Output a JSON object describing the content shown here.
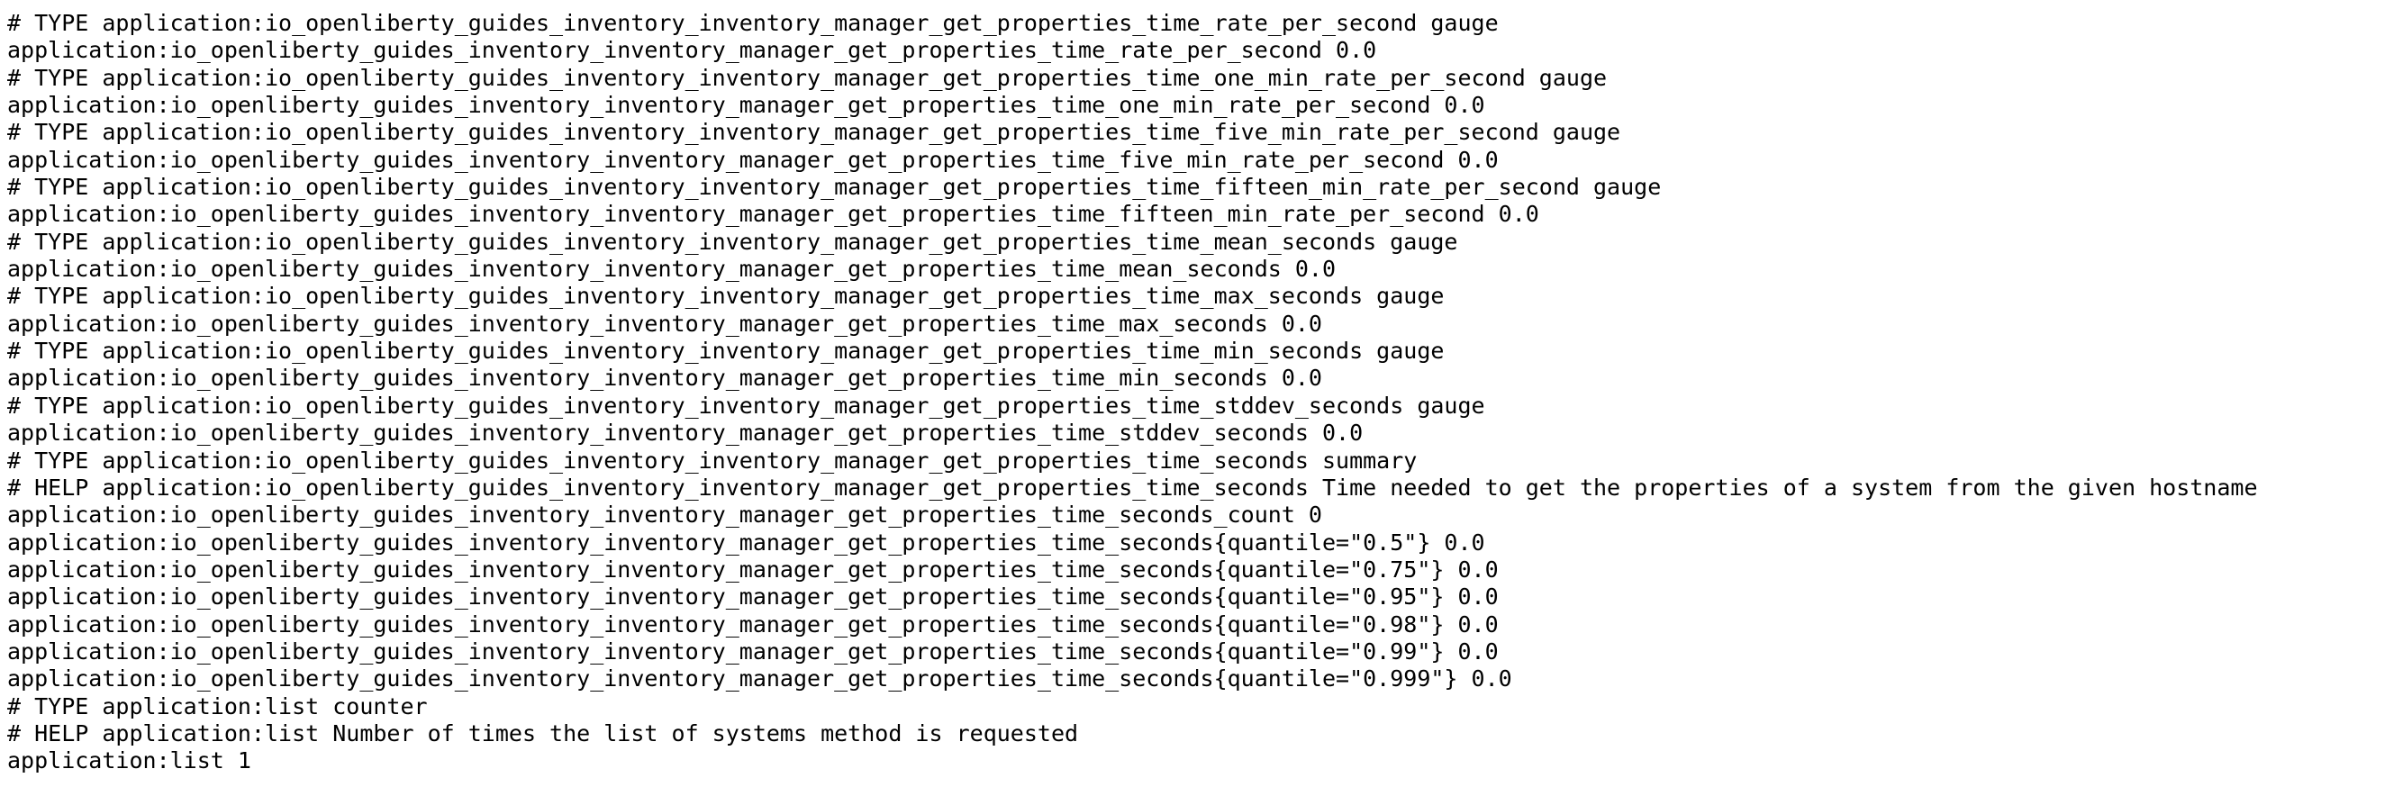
{
  "metrics": {
    "lines": [
      "# TYPE application:io_openliberty_guides_inventory_inventory_manager_get_properties_time_rate_per_second gauge",
      "application:io_openliberty_guides_inventory_inventory_manager_get_properties_time_rate_per_second 0.0",
      "# TYPE application:io_openliberty_guides_inventory_inventory_manager_get_properties_time_one_min_rate_per_second gauge",
      "application:io_openliberty_guides_inventory_inventory_manager_get_properties_time_one_min_rate_per_second 0.0",
      "# TYPE application:io_openliberty_guides_inventory_inventory_manager_get_properties_time_five_min_rate_per_second gauge",
      "application:io_openliberty_guides_inventory_inventory_manager_get_properties_time_five_min_rate_per_second 0.0",
      "# TYPE application:io_openliberty_guides_inventory_inventory_manager_get_properties_time_fifteen_min_rate_per_second gauge",
      "application:io_openliberty_guides_inventory_inventory_manager_get_properties_time_fifteen_min_rate_per_second 0.0",
      "# TYPE application:io_openliberty_guides_inventory_inventory_manager_get_properties_time_mean_seconds gauge",
      "application:io_openliberty_guides_inventory_inventory_manager_get_properties_time_mean_seconds 0.0",
      "# TYPE application:io_openliberty_guides_inventory_inventory_manager_get_properties_time_max_seconds gauge",
      "application:io_openliberty_guides_inventory_inventory_manager_get_properties_time_max_seconds 0.0",
      "# TYPE application:io_openliberty_guides_inventory_inventory_manager_get_properties_time_min_seconds gauge",
      "application:io_openliberty_guides_inventory_inventory_manager_get_properties_time_min_seconds 0.0",
      "# TYPE application:io_openliberty_guides_inventory_inventory_manager_get_properties_time_stddev_seconds gauge",
      "application:io_openliberty_guides_inventory_inventory_manager_get_properties_time_stddev_seconds 0.0",
      "# TYPE application:io_openliberty_guides_inventory_inventory_manager_get_properties_time_seconds summary",
      "# HELP application:io_openliberty_guides_inventory_inventory_manager_get_properties_time_seconds Time needed to get the properties of a system from the given hostname",
      "application:io_openliberty_guides_inventory_inventory_manager_get_properties_time_seconds_count 0",
      "application:io_openliberty_guides_inventory_inventory_manager_get_properties_time_seconds{quantile=\"0.5\"} 0.0",
      "application:io_openliberty_guides_inventory_inventory_manager_get_properties_time_seconds{quantile=\"0.75\"} 0.0",
      "application:io_openliberty_guides_inventory_inventory_manager_get_properties_time_seconds{quantile=\"0.95\"} 0.0",
      "application:io_openliberty_guides_inventory_inventory_manager_get_properties_time_seconds{quantile=\"0.98\"} 0.0",
      "application:io_openliberty_guides_inventory_inventory_manager_get_properties_time_seconds{quantile=\"0.99\"} 0.0",
      "application:io_openliberty_guides_inventory_inventory_manager_get_properties_time_seconds{quantile=\"0.999\"} 0.0",
      "# TYPE application:list counter",
      "# HELP application:list Number of times the list of systems method is requested",
      "application:list 1"
    ]
  }
}
